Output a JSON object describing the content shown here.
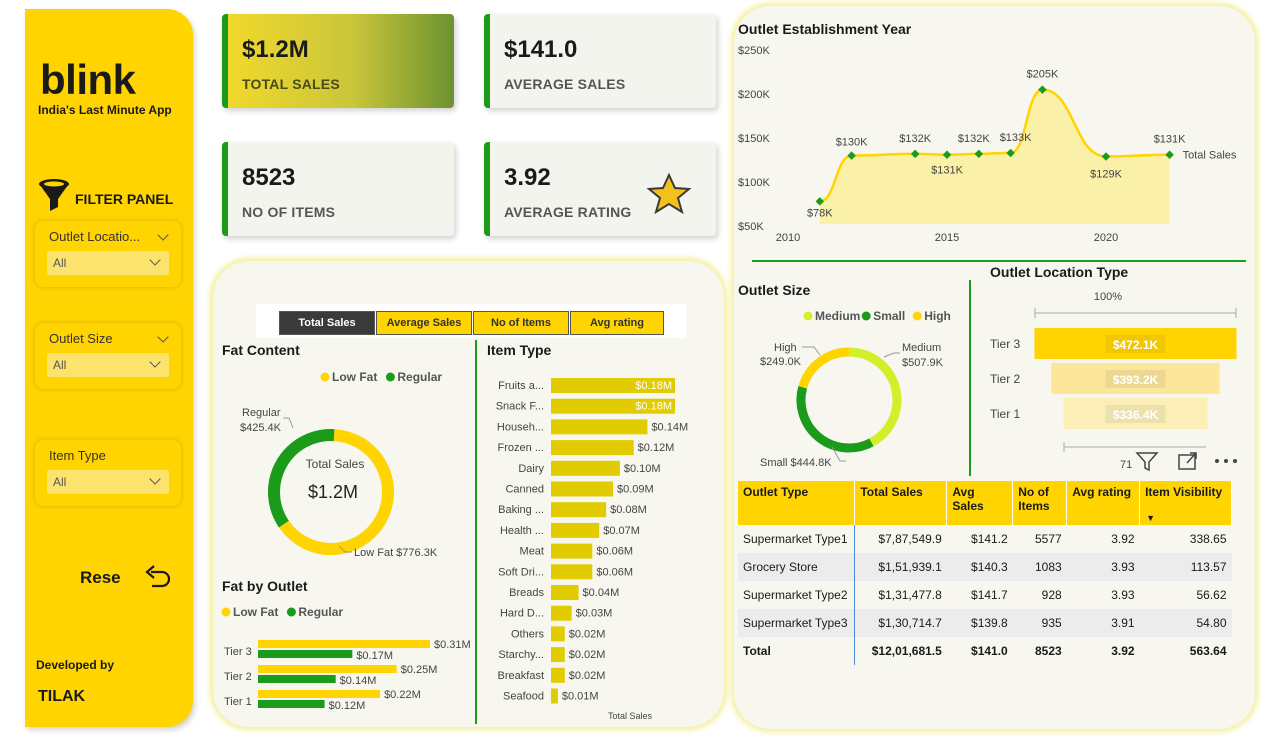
{
  "sidebar": {
    "brand": "blink",
    "tagline": "India's Last Minute App",
    "filter_panel_label": "FILTER PANEL",
    "slicers": [
      {
        "title": "Outlet Locatio...",
        "value": "All"
      },
      {
        "title": "Outlet Size",
        "value": "All"
      },
      {
        "title": "Item Type",
        "value": "All"
      }
    ],
    "reset_label": "Rese",
    "developed_by_label": "Developed by",
    "author": "TILAK"
  },
  "kpis": [
    {
      "value": "$1.2M",
      "label": "TOTAL SALES"
    },
    {
      "value": "$141.0",
      "label": "AVERAGE SALES"
    },
    {
      "value": "8523",
      "label": "NO OF ITEMS"
    },
    {
      "value": "3.92",
      "label": "AVERAGE RATING"
    }
  ],
  "metric_tabs": [
    "Total Sales",
    "Average Sales",
    "No of Items",
    "Avg rating"
  ],
  "colors": {
    "yellow": "#ffd400",
    "green": "#1a9b1a",
    "lime": "#d2ef2a",
    "dark_yellow": "#e0cc00"
  },
  "chart_data": [
    {
      "type": "donut",
      "title": "Fat Content",
      "legend": [
        "Low Fat",
        "Regular"
      ],
      "center_label": "Total Sales",
      "center_value": "$1.2M",
      "slices": [
        {
          "name": "Low Fat",
          "value": 776.3,
          "label": "Low Fat $776.3K"
        },
        {
          "name": "Regular",
          "value": 425.4,
          "label": "Regular\n$425.4K"
        }
      ]
    },
    {
      "type": "bar",
      "title": "Fat by Outlet",
      "legend": [
        "Low Fat",
        "Regular"
      ],
      "categories": [
        "Tier 3",
        "Tier 2",
        "Tier 1"
      ],
      "series": [
        {
          "name": "Low Fat",
          "values": [
            0.31,
            0.25,
            0.22
          ],
          "labels": [
            "$0.31M",
            "$0.25M",
            "$0.22M"
          ]
        },
        {
          "name": "Regular",
          "values": [
            0.17,
            0.14,
            0.12
          ],
          "labels": [
            "$0.17M",
            "$0.14M",
            "$0.12M"
          ]
        }
      ]
    },
    {
      "type": "bar",
      "title": "Item Type",
      "xlabel": "Total Sales",
      "categories": [
        "Fruits a...",
        "Snack F...",
        "Househ...",
        "Frozen ...",
        "Dairy",
        "Canned",
        "Baking ...",
        "Health ...",
        "Meat",
        "Soft Dri...",
        "Breads",
        "Hard D...",
        "Others",
        "Starchy...",
        "Breakfast",
        "Seafood"
      ],
      "values": [
        0.18,
        0.18,
        0.14,
        0.12,
        0.1,
        0.09,
        0.08,
        0.07,
        0.06,
        0.06,
        0.04,
        0.03,
        0.02,
        0.02,
        0.02,
        0.01
      ],
      "labels": [
        "$0.18M",
        "$0.18M",
        "$0.14M",
        "$0.12M",
        "$0.10M",
        "$0.09M",
        "$0.08M",
        "$0.07M",
        "$0.06M",
        "$0.06M",
        "$0.04M",
        "$0.03M",
        "$0.02M",
        "$0.02M",
        "$0.02M",
        "$0.01M"
      ]
    },
    {
      "type": "area",
      "title": "Outlet Establishment Year",
      "series_name": "Total Sales",
      "x": [
        2011,
        2012,
        2014,
        2015,
        2016,
        2017,
        2018,
        2020,
        2022
      ],
      "values": [
        78,
        130,
        132,
        131,
        132,
        133,
        205,
        129,
        131
      ],
      "labels": [
        "$78K",
        "$130K",
        "$132K",
        "$131K",
        "$132K",
        "$133K",
        "$205K",
        "$129K",
        "$131K"
      ],
      "y_ticks": [
        "$250K",
        "$200K",
        "$150K",
        "$100K",
        "$50K"
      ],
      "x_ticks": [
        "2010",
        "2015",
        "2020"
      ],
      "ylim": [
        50,
        250
      ]
    },
    {
      "type": "donut",
      "title": "Outlet Size",
      "legend": [
        "Medium",
        "Small",
        "High"
      ],
      "slices": [
        {
          "name": "Medium",
          "value": 507.9,
          "label": "Medium\n$507.9K"
        },
        {
          "name": "Small",
          "value": 444.8,
          "label": "Small $444.8K"
        },
        {
          "name": "High",
          "value": 249.0,
          "label": "High\n$249.0K"
        }
      ]
    },
    {
      "type": "bar",
      "title": "Outlet Location Type",
      "subtitle": "100%",
      "categories": [
        "Tier 3",
        "Tier 2",
        "Tier 1"
      ],
      "values": [
        472.1,
        393.2,
        336.4
      ],
      "labels": [
        "$472.1K",
        "$393.2K",
        "$336.4K"
      ],
      "axis_value": "71"
    }
  ],
  "outlet_table": {
    "headers": [
      "Outlet Type",
      "Total Sales",
      "Avg Sales",
      "No of Items",
      "Avg rating",
      "Item Visibility"
    ],
    "rows": [
      [
        "Supermarket Type1",
        "$7,87,549.9",
        "$141.2",
        "5577",
        "3.92",
        "338.65"
      ],
      [
        "Grocery Store",
        "$1,51,939.1",
        "$140.3",
        "1083",
        "3.93",
        "113.57"
      ],
      [
        "Supermarket Type2",
        "$1,31,477.8",
        "$141.7",
        "928",
        "3.93",
        "56.62"
      ],
      [
        "Supermarket Type3",
        "$1,30,714.7",
        "$139.8",
        "935",
        "3.91",
        "54.80"
      ]
    ],
    "total": [
      "Total",
      "$12,01,681.5",
      "$141.0",
      "8523",
      "3.92",
      "563.64"
    ]
  }
}
